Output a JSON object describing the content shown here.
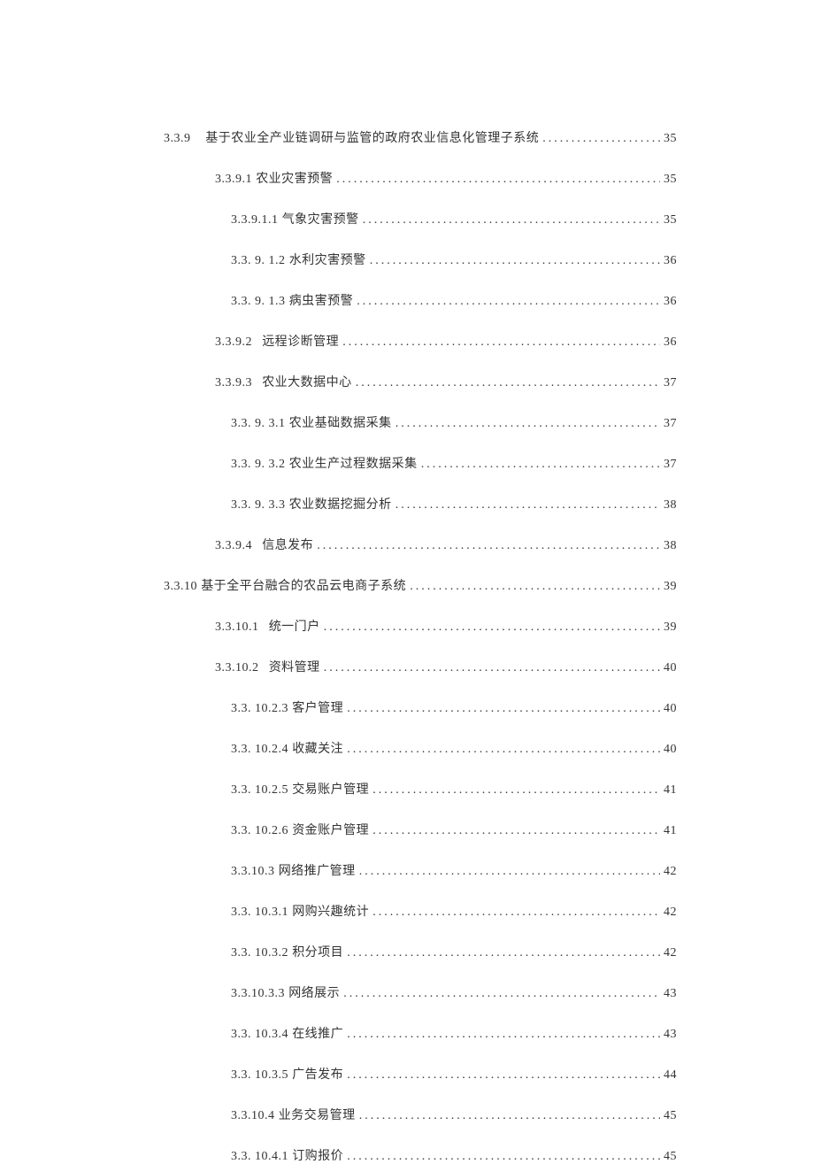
{
  "toc": [
    {
      "level": 1,
      "num": "3.3.9",
      "gap": "wide",
      "title": "基于农业全产业链调研与监管的政府农业信息化管理子系统",
      "page": "35"
    },
    {
      "level": 2,
      "num": "3.3.9.1",
      "gap": "",
      "title": "农业灾害预警",
      "page": "35"
    },
    {
      "level": 3,
      "num": "3.3.9.1.1",
      "gap": "",
      "title": "气象灾害预警",
      "page": "35"
    },
    {
      "level": 3,
      "num": "3.3. 9. 1.2",
      "gap": "",
      "title": "水利灾害预警",
      "page": "36"
    },
    {
      "level": 3,
      "num": "3.3. 9. 1.3",
      "gap": "",
      "title": "病虫害预警",
      "page": "36"
    },
    {
      "level": 2,
      "num": "3.3.9.2",
      "gap": "med",
      "title": "远程诊断管理",
      "page": "36"
    },
    {
      "level": 2,
      "num": "3.3.9.3",
      "gap": "med",
      "title": "农业大数据中心",
      "page": "37"
    },
    {
      "level": 3,
      "num": "3.3. 9. 3.1",
      "gap": "",
      "title": "农业基础数据采集",
      "page": "37"
    },
    {
      "level": 3,
      "num": "3.3. 9. 3.2",
      "gap": "",
      "title": "农业生产过程数据采集",
      "page": "37"
    },
    {
      "level": 3,
      "num": "3.3. 9. 3.3",
      "gap": "",
      "title": "农业数据挖掘分析",
      "page": "38"
    },
    {
      "level": 2,
      "num": "3.3.9.4",
      "gap": "med",
      "title": "信息发布",
      "page": "38"
    },
    {
      "level": 1,
      "num": "3.3.10",
      "gap": "",
      "title": "基于全平台融合的农品云电商子系统",
      "page": "39"
    },
    {
      "level": 2,
      "num": "3.3.10.1",
      "gap": "med",
      "title": "统一门户",
      "page": "39"
    },
    {
      "level": 2,
      "num": "3.3.10.2",
      "gap": "med",
      "title": "资料管理",
      "page": "40"
    },
    {
      "level": 3,
      "num": "3.3. 10.2.3",
      "gap": "",
      "title": "客户管理",
      "page": "40"
    },
    {
      "level": 3,
      "num": "3.3. 10.2.4",
      "gap": "",
      "title": "收藏关注",
      "page": "40"
    },
    {
      "level": 3,
      "num": "3.3. 10.2.5",
      "gap": "",
      "title": "交易账户管理",
      "page": "41"
    },
    {
      "level": 3,
      "num": "3.3. 10.2.6",
      "gap": "",
      "title": "资金账户管理",
      "page": "41"
    },
    {
      "level": 3,
      "num": "3.3.10.3",
      "gap": "",
      "title": "网络推广管理",
      "page": "42"
    },
    {
      "level": 3,
      "num": "3.3. 10.3.1",
      "gap": "",
      "title": "网购兴趣统计",
      "page": "42"
    },
    {
      "level": 3,
      "num": "3.3. 10.3.2",
      "gap": "",
      "title": "积分项目",
      "page": "42"
    },
    {
      "level": 3,
      "num": "3.3.10.3.3",
      "gap": "",
      "title": "网络展示",
      "page": "43"
    },
    {
      "level": 3,
      "num": "3.3. 10.3.4",
      "gap": "",
      "title": "在线推广",
      "page": "43"
    },
    {
      "level": 3,
      "num": "3.3. 10.3.5",
      "gap": "",
      "title": "广告发布",
      "page": "44"
    },
    {
      "level": 3,
      "num": "3.3.10.4",
      "gap": "",
      "title": "业务交易管理",
      "page": "45"
    },
    {
      "level": 3,
      "num": "3.3. 10.4.1",
      "gap": "",
      "title": "订购报价",
      "page": "45"
    }
  ]
}
